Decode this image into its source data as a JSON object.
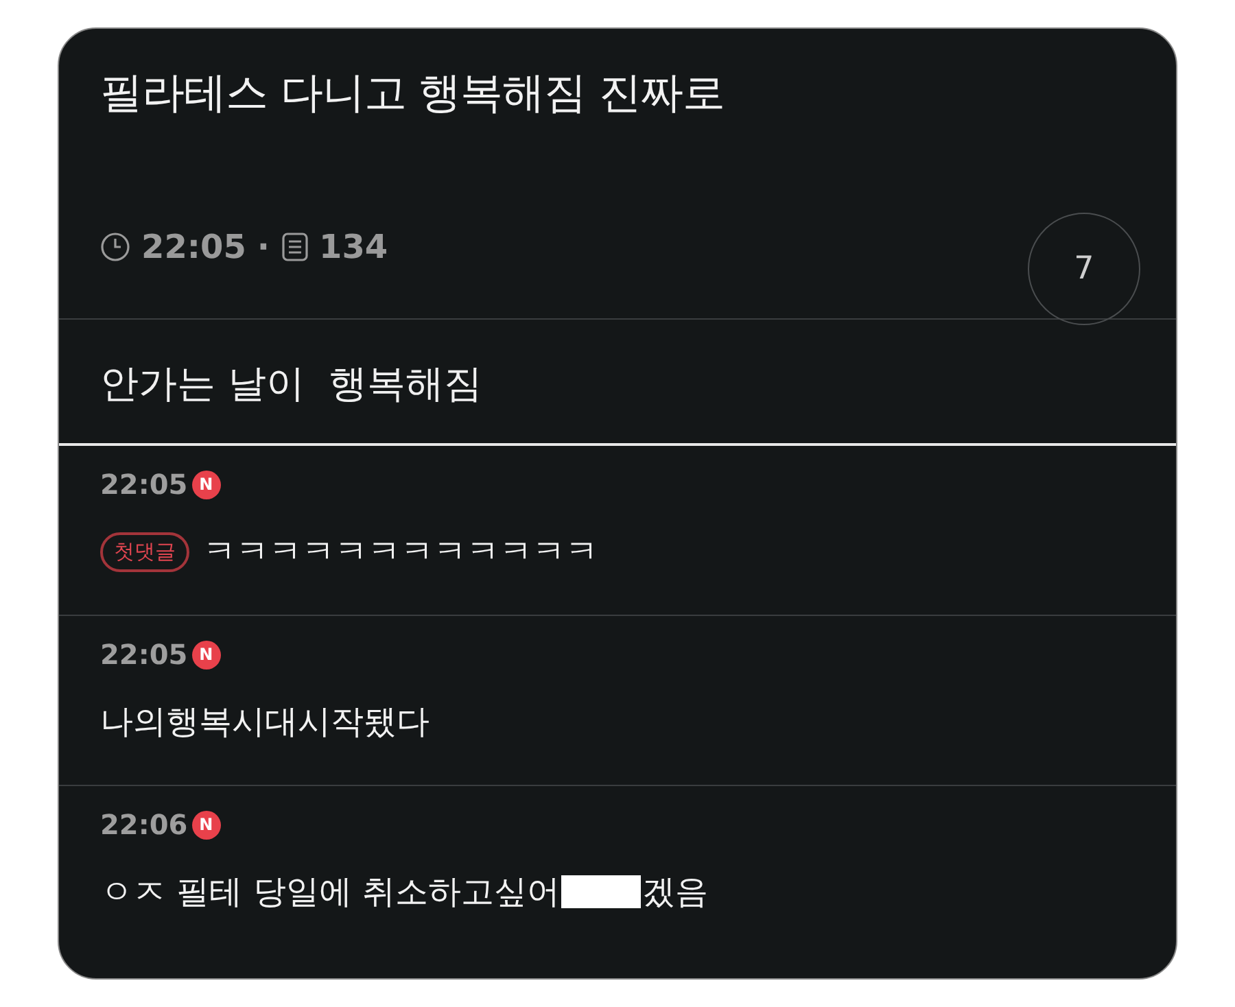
{
  "post": {
    "title": "필라테스 다니고 행복해짐 진짜로",
    "time": "22:05",
    "separator": "·",
    "views": "134",
    "comment_count": "7",
    "body": "안가는 날이  행복해짐"
  },
  "comments": [
    {
      "time": "22:05",
      "new_badge": "N",
      "badge": "첫댓글",
      "parts": [
        {
          "kind": "text",
          "text": "ㅋㅋㅋㅋㅋㅋㅋㅋㅋㅋㅋㅋ"
        }
      ]
    },
    {
      "time": "22:05",
      "new_badge": "N",
      "parts": [
        {
          "kind": "text",
          "text": "나의행복시대시작됐다"
        }
      ]
    },
    {
      "time": "22:06",
      "new_badge": "N",
      "parts": [
        {
          "kind": "text",
          "text": "ㅇㅈ 필테 당일에 취소하고싶어"
        },
        {
          "kind": "redacted"
        },
        {
          "kind": "text",
          "text": "겠음"
        }
      ]
    }
  ]
}
